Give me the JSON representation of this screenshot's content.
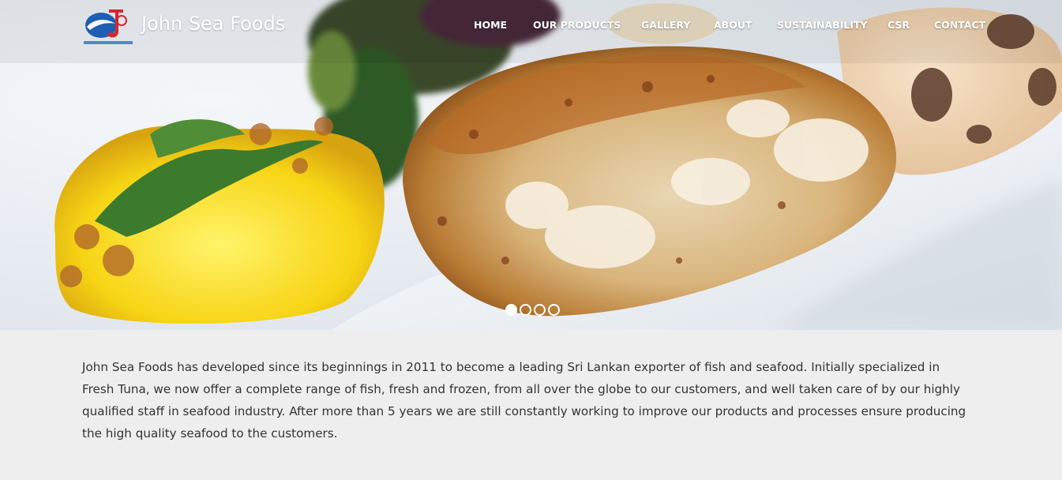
{
  "header": {
    "brand": "John Sea Foods",
    "logo_icon": "john-seafoods-logo-icon"
  },
  "nav": {
    "items": [
      {
        "label": "HOME"
      },
      {
        "label": "OUR PRODUCTS"
      },
      {
        "label": "GALLERY"
      },
      {
        "label": "ABOUT"
      },
      {
        "label": "SUSTAINABILITY"
      },
      {
        "label": "CSR"
      },
      {
        "label": "CONTACT"
      }
    ]
  },
  "carousel": {
    "slide_count": 4,
    "active_index": 0
  },
  "intro": {
    "text": "John Sea Foods has developed since its beginnings in 2011 to become a leading Sri Lankan exporter of fish and seafood. Initially specialized in Fresh Tuna, we now offer a complete range of fish, fresh and frozen, from all over the globe to our customers, and well taken care of by our highly qualified staff in seafood industry. After more than 5 years we are still constantly working to improve our products and processes ensure producing the high quality seafood to the customers."
  },
  "colors": {
    "page_bg": "#eeeeee",
    "text": "#333333",
    "nav_text": "#ffffff"
  }
}
